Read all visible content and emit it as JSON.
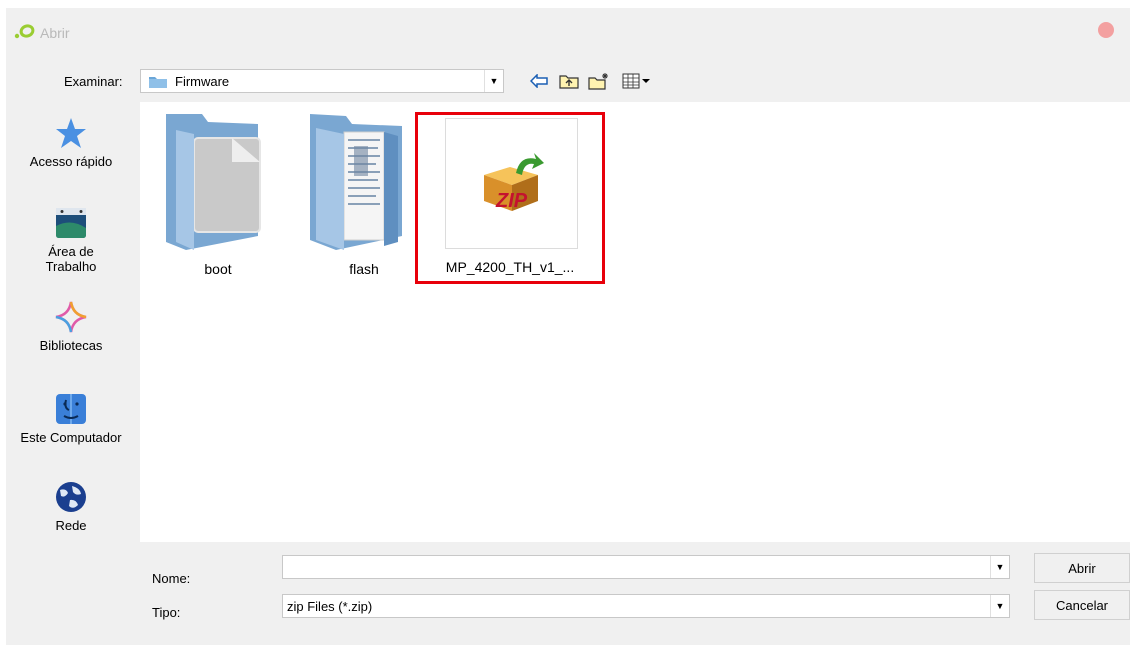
{
  "window": {
    "title": "Abrir"
  },
  "toolbar": {
    "look_in_label": "Examinar:",
    "look_in_value": "Firmware",
    "back_icon": "back-arrow-icon",
    "up_icon": "up-folder-icon",
    "new_folder_icon": "new-folder-icon",
    "view_icon": "view-menu-icon"
  },
  "places": [
    {
      "label": "Acesso rápido",
      "icon": "star-icon"
    },
    {
      "label": "Área de\nTrabalho",
      "icon": "desktop-icon"
    },
    {
      "label": "Bibliotecas",
      "icon": "libraries-icon"
    },
    {
      "label": "Este Computador",
      "icon": "computer-icon"
    },
    {
      "label": "Rede",
      "icon": "network-globe-icon"
    }
  ],
  "files": [
    {
      "name": "boot",
      "icon": "folder-icon"
    },
    {
      "name": "flash",
      "icon": "folder-icon"
    },
    {
      "name": "MP_4200_TH_v1_...",
      "icon": "zip-archive-icon"
    }
  ],
  "form": {
    "name_label": "Nome:",
    "name_value": "",
    "type_label": "Tipo:",
    "type_value": "zip Files (*.zip)",
    "open_button": "Abrir",
    "cancel_button": "Cancelar"
  },
  "colors": {
    "highlight_border": "#e8000a",
    "folder_blue": "#8fb6de"
  }
}
